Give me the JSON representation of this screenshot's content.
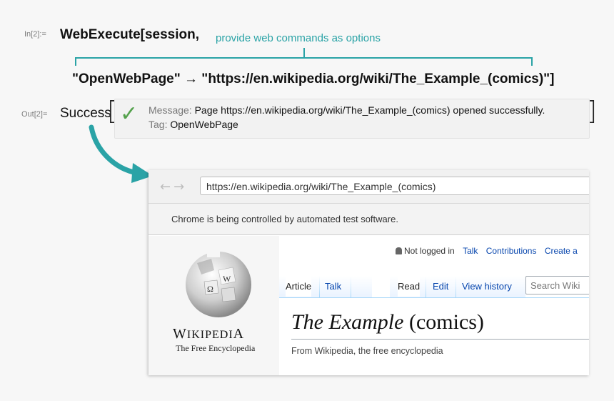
{
  "notebook": {
    "in_label": "In[2]:=",
    "out_label": "Out[2]=",
    "code_line1": "WebExecute[session,",
    "code_line2": "\"OpenWebPage\" → \"https://en.wikipedia.org/wiki/The_Example_(comics)\"]",
    "annotation": "provide web commands as options",
    "annotation_color": "#2aa3a6",
    "result_head": "Success",
    "message_key": "Message:",
    "message_value": "Page https://en.wikipedia.org/wiki/The_Example_(comics) opened successfully.",
    "tag_key": "Tag:",
    "tag_value": "OpenWebPage",
    "check_icon": "checkmark-icon",
    "check_color": "#53a14b"
  },
  "browser": {
    "url": "https://en.wikipedia.org/wiki/The_Example_(comics)",
    "infobar": "Chrome is being controlled by automated test software.",
    "personal": {
      "not_logged_in": "Not logged in",
      "talk": "Talk",
      "contributions": "Contributions",
      "create": "Create a"
    },
    "tabs_left": [
      "Article",
      "Talk"
    ],
    "tabs_right": [
      "Read",
      "Edit",
      "View history"
    ],
    "search_placeholder": "Search Wiki",
    "page_title_italic": "The Example",
    "page_title_rest": " (comics)",
    "tagline": "From Wikipedia, the free encyclopedia",
    "logo": {
      "wordmark_big1": "W",
      "wordmark_small": "IKIPEDI",
      "wordmark_big2": "A",
      "tagline": "The Free Encyclopedia"
    },
    "link_color": "#0645ad"
  }
}
